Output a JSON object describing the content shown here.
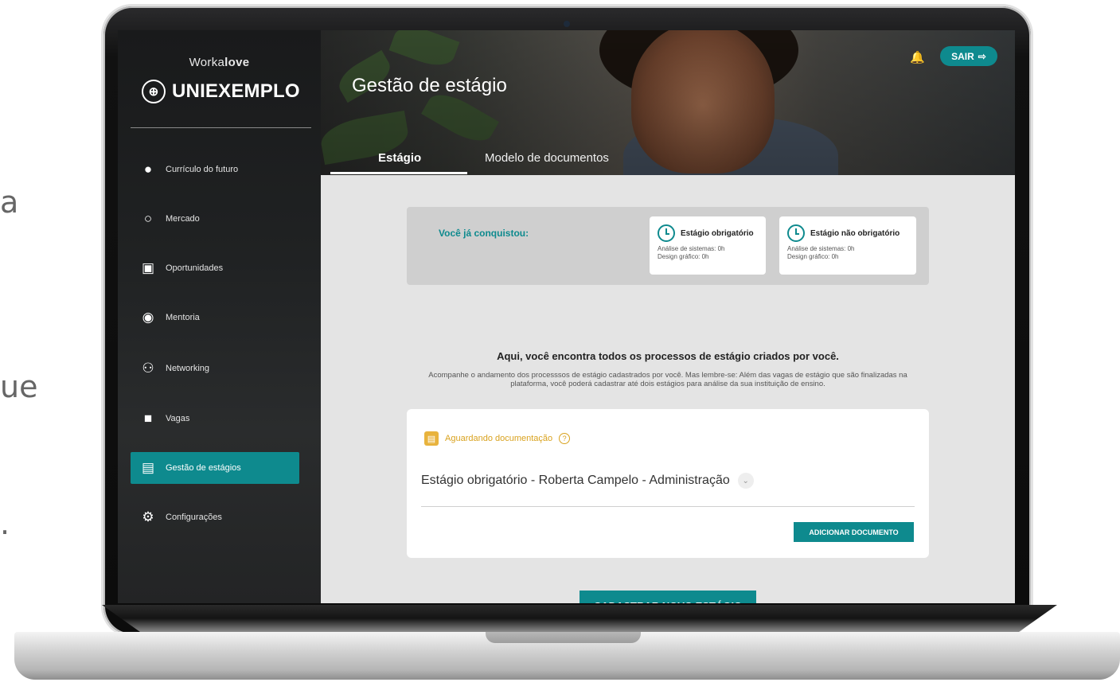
{
  "background_fragments": [
    "a",
    "ue",
    "."
  ],
  "sidebar": {
    "brand_prefix": "Worka",
    "brand_suffix": "love",
    "institution": "UNIEXEMPLO",
    "items": [
      {
        "label": "Currículo do futuro",
        "icon": "user-circle-icon"
      },
      {
        "label": "Mercado",
        "icon": "search-icon"
      },
      {
        "label": "Oportunidades",
        "icon": "cast-icon"
      },
      {
        "label": "Mentoria",
        "icon": "chat-icon"
      },
      {
        "label": "Networking",
        "icon": "people-icon"
      },
      {
        "label": "Vagas",
        "icon": "briefcase-icon"
      },
      {
        "label": "Gestão de estágios",
        "icon": "document-icon",
        "active": true
      },
      {
        "label": "Configurações",
        "icon": "gear-icon"
      }
    ]
  },
  "header": {
    "title": "Gestão de estágio",
    "logout_label": "SAIR",
    "tabs": [
      {
        "label": "Estágio",
        "active": true
      },
      {
        "label": "Modelo de documentos"
      }
    ]
  },
  "achievements": {
    "label": "Você já conquistou:",
    "cards": [
      {
        "title": "Estágio obrigatório",
        "lines": [
          "Análise de sistemas: 0h",
          "Design gráfico: 0h"
        ]
      },
      {
        "title": "Estágio não obrigatório",
        "lines": [
          "Análise de sistemas: 0h",
          "Design gráfico: 0h"
        ]
      }
    ]
  },
  "intro": {
    "title": "Aqui, você encontra todos os processos de estágio criados por você.",
    "description": "Acompanhe o andamento dos processsos de estágio cadastrados por você. Mas lembre-se: Além das vagas de estágio que são finalizadas na plataforma, você poderá cadastrar até dois estágios para análise da sua instituição de ensino."
  },
  "process": {
    "status": "Aguardando documentação",
    "name": "Estágio obrigatório - Roberta Campelo - Administração",
    "add_document_label": "ADICIONAR DOCUMENTO"
  },
  "new_stage_label": "CADASTRAR NOVO ESTÁGIO",
  "colors": {
    "accent": "#0e8a8e",
    "warning": "#d9a21e",
    "sidebar_bg": "#1f2021"
  }
}
